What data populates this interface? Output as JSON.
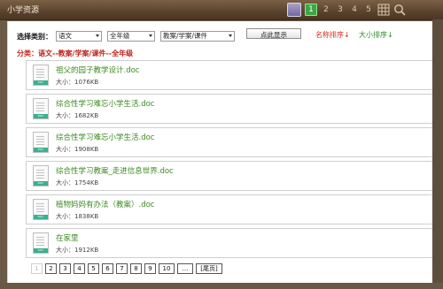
{
  "window": {
    "title": "小学资源"
  },
  "toolbar": {
    "pages": [
      "1",
      "2",
      "3",
      "4",
      "5"
    ],
    "active_page": "1"
  },
  "filters": {
    "label": "选择类别：",
    "subject": "语文",
    "grade": "全年级",
    "type": "教案/学案/课件",
    "search_button": "点此显示",
    "sort_by_name": "名称排序↓",
    "sort_by_size": "大小排序↓"
  },
  "category_line": "分类：语文--教案/学案/课件--全年级",
  "files": [
    {
      "name": "祖父的园子教学设计.doc",
      "size": "大小：1076KB",
      "tag": "DOC"
    },
    {
      "name": "综合性学习难忘小学生活.doc",
      "size": "大小：1682KB",
      "tag": "DOC"
    },
    {
      "name": "综合性学习难忘小学生活.doc",
      "size": "大小：1908KB",
      "tag": "DOC"
    },
    {
      "name": "综合性学习教案_走进信息世界.doc",
      "size": "大小：1754KB",
      "tag": "DOC"
    },
    {
      "name": "植物妈妈有办法（教案）.doc",
      "size": "大小：1838KB",
      "tag": "DOC"
    },
    {
      "name": "在家里",
      "size": "大小：1912KB",
      "tag": "DOC"
    }
  ],
  "pagination": {
    "pages": [
      "1",
      "2",
      "3",
      "4",
      "5",
      "6",
      "7",
      "8",
      "9",
      "10"
    ],
    "current": "1",
    "ellipsis": "...",
    "last": "[尾页]"
  }
}
